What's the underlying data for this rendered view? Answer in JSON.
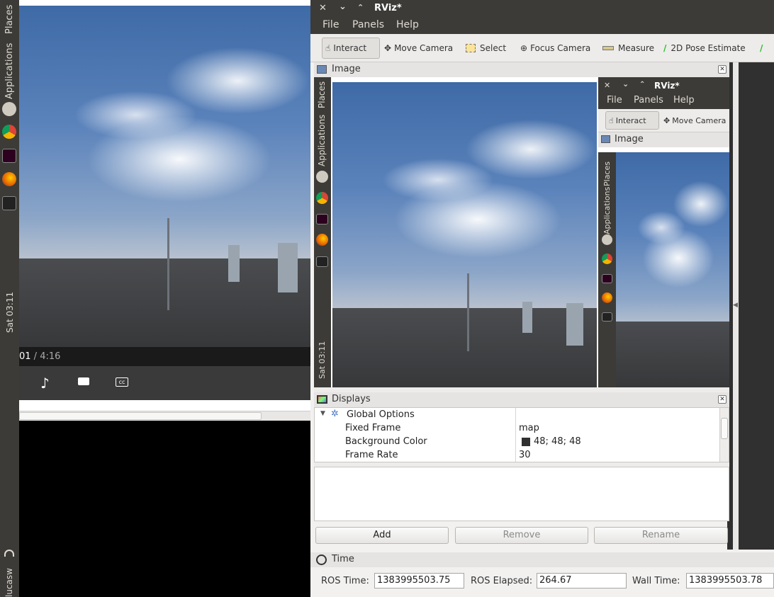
{
  "launcher": {
    "menu_applications": "Applications",
    "menu_places": "Places",
    "clock": "Sat 03:11",
    "user": "lucasw"
  },
  "video": {
    "time_current": "01",
    "time_sep_total": " / 4:16"
  },
  "rviz": {
    "title": "RViz*",
    "menu": [
      "File",
      "Panels",
      "Help"
    ],
    "tools": {
      "interact": "Interact",
      "move_camera": "Move Camera",
      "select": "Select",
      "focus_camera": "Focus Camera",
      "measure": "Measure",
      "pose_estimate": "2D Pose Estimate"
    },
    "image_panel_title": "Image",
    "nested": {
      "title": "RViz*",
      "menu": [
        "File",
        "Panels",
        "Help"
      ],
      "interact": "Interact",
      "move_camera": "Move Camera",
      "image_panel_title": "Image",
      "menu_applications": "Applications",
      "menu_places": "Places",
      "nested2": {
        "menu_applications": "Applications",
        "menu_places": "Places"
      }
    },
    "inner_launcher": {
      "menu_applications": "Applications",
      "menu_places": "Places",
      "clock": "Sat 03:11"
    },
    "displays": {
      "title": "Displays",
      "group": "Global Options",
      "rows": [
        {
          "name": "Fixed Frame",
          "value": "map"
        },
        {
          "name": "Background Color",
          "value": "48; 48; 48",
          "swatch": "#303030"
        },
        {
          "name": "Frame Rate",
          "value": "30"
        }
      ],
      "buttons": {
        "add": "Add",
        "remove": "Remove",
        "rename": "Rename"
      }
    },
    "time": {
      "title": "Time",
      "ros_time_label": "ROS Time:",
      "ros_time": "1383995503.75",
      "ros_elapsed_label": "ROS Elapsed:",
      "ros_elapsed": "264.67",
      "wall_time_label": "Wall Time:",
      "wall_time": "1383995503.78"
    }
  },
  "colors": {
    "launcher_bg": "#3c3b37",
    "titlebar_bg": "#3c3b37",
    "panel_bg": "#f2f1f0"
  }
}
